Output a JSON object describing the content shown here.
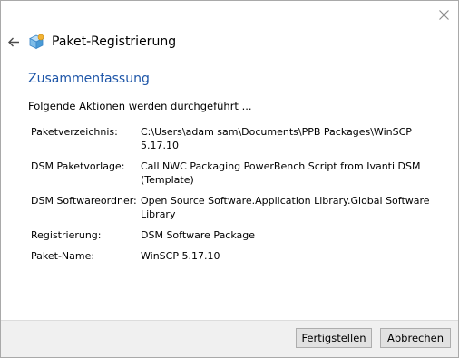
{
  "window": {
    "title": "Paket-Registrierung"
  },
  "icons": {
    "close": "close-icon",
    "back": "back-arrow-icon",
    "app": "package-icon"
  },
  "colors": {
    "heading": "#1e56a8",
    "footer_background": "#f0f0f0",
    "button_background": "#e1e1e1"
  },
  "main": {
    "heading": "Zusammenfassung",
    "intro": "Folgende Aktionen werden durchgeführt ...",
    "details": [
      {
        "label": "Paketverzeichnis:",
        "value": "C:\\Users\\adam sam\\Documents\\PPB Packages\\WinSCP 5.17.10"
      },
      {
        "label": "DSM Paketvorlage:",
        "value": "Call NWC Packaging PowerBench Script from Ivanti DSM (Template)"
      },
      {
        "label": "DSM Softwareordner:",
        "value": "Open Source Software.Application Library.Global Software Library"
      },
      {
        "label": "Registrierung:",
        "value": "DSM Software Package"
      },
      {
        "label": "Paket-Name:",
        "value": "WinSCP 5.17.10"
      }
    ]
  },
  "footer": {
    "finish_label": "Fertigstellen",
    "cancel_label": "Abbrechen"
  }
}
